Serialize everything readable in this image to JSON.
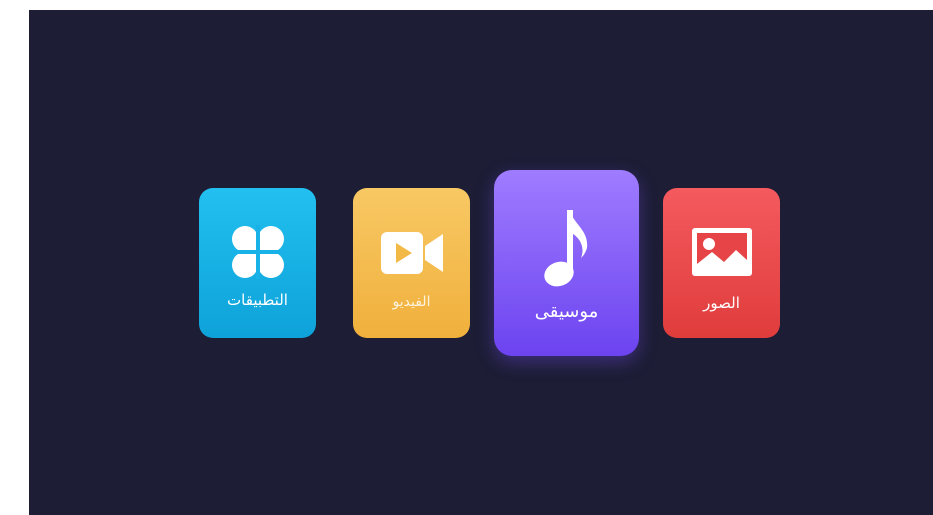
{
  "launcher": {
    "tiles": [
      {
        "id": "apps",
        "label": "التطبيقات",
        "icon": "apps-clover-icon",
        "color": "#1ab4e8"
      },
      {
        "id": "video",
        "label": "الفيديو",
        "icon": "video-camera-icon",
        "color": "#f5bd4f"
      },
      {
        "id": "music",
        "label": "موسيقى",
        "icon": "music-note-icon",
        "color": "#8360f8",
        "focused": true
      },
      {
        "id": "photos",
        "label": "الصور",
        "icon": "image-icon",
        "color": "#ea4a4c"
      }
    ]
  },
  "colors": {
    "background": "#1d1d35"
  }
}
